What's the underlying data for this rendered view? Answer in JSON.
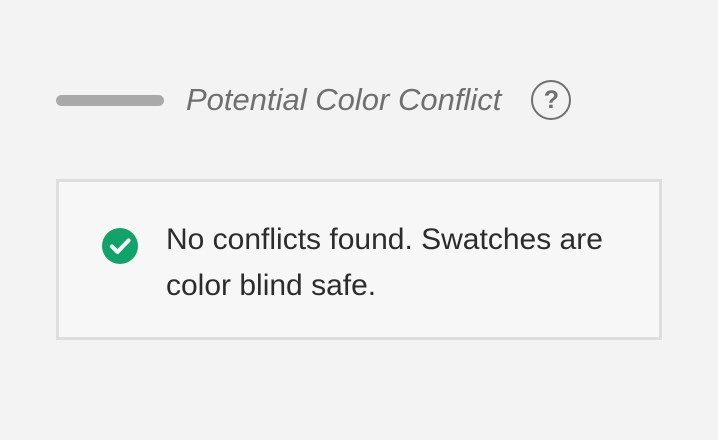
{
  "legend": {
    "label": "Potential Color Conflict",
    "help_icon": "help-icon",
    "help_glyph": "?",
    "swatch_color": "#a9a9a9"
  },
  "status": {
    "icon": "check-circle-icon",
    "icon_color": "#12a36a",
    "message": "No conflicts found. Swatches are color blind safe."
  }
}
